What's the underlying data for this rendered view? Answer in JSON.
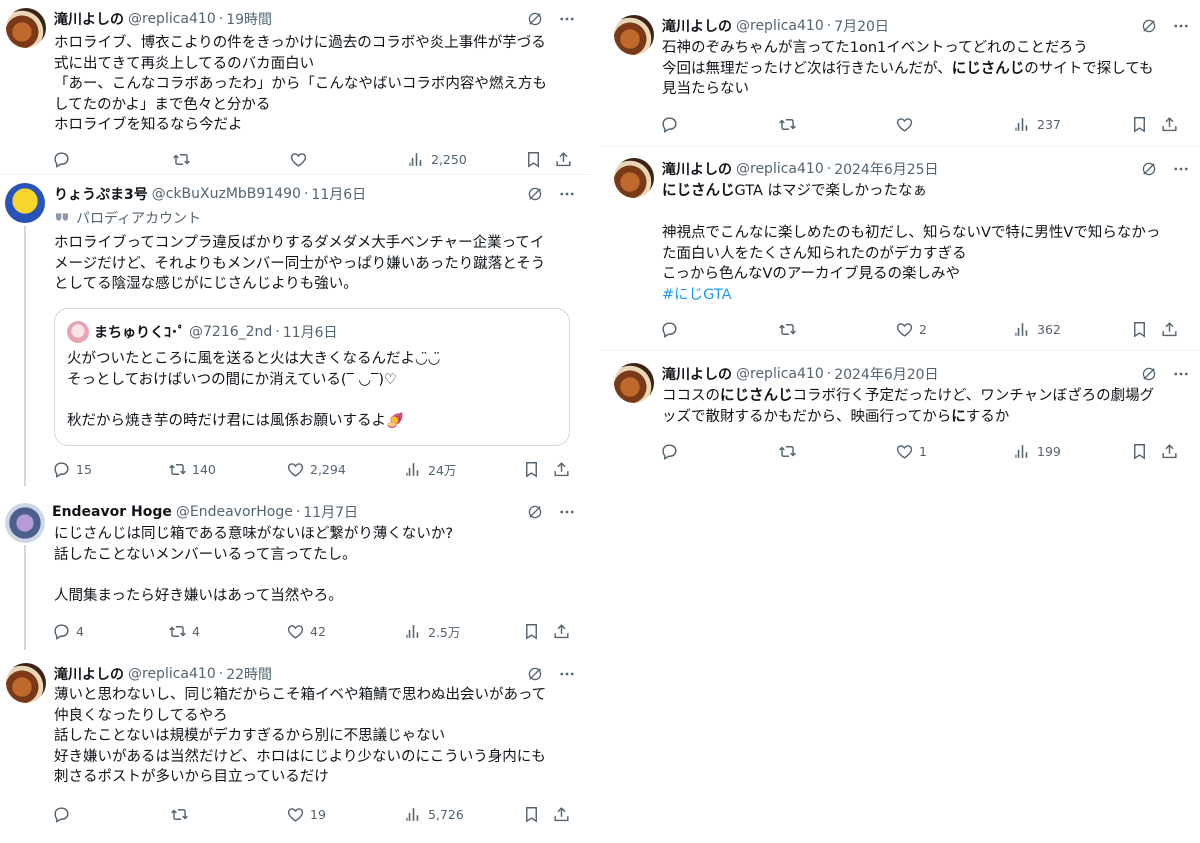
{
  "left": {
    "tweets": [
      {
        "name": "滝川よしの",
        "handle": "@replica410",
        "time": "19時間",
        "text": "ホロライブ、博衣こよりの件をきっかけに過去のコラボや炎上事件が芋づる\n式に出てきて再炎上してるのバカ面白い\n「あー、こんなコラボあったわ」から「こんなやばいコラボ内容や燃え方も\nしてたのかよ」まで色々と分かる\nホロライブを知るなら今だよ",
        "replies": "",
        "retweets": "",
        "likes": "",
        "views": "2,250"
      },
      {
        "name": "りょうぷま3号",
        "handle": "@ckBuXuzMbB91490",
        "time": "11月6日",
        "parody_label": "パロディアカウント",
        "text": "ホロライブってコンプラ違反ばかりするダメダメ大手ベンチャー企業ってイ\nメージだけど、それよりもメンバー同士がやっぱり嫌いあったり蹴落とそう\nとしてる陰湿な感じがにじさんじよりも強い。",
        "quote": {
          "name": "まちゅりくｺ･ﾟ",
          "handle": "@7216_2nd",
          "time": "11月6日",
          "text": "火がついたところに風を送ると火は大きくなるんだよ◡̈◡̈\nそっとしておけばいつの間にか消えている(‾ ◡‾)♡\n\n秋だから焼き芋の時だけ君には風係お願いするよ🍠"
        },
        "replies": "15",
        "retweets": "140",
        "likes": "2,294",
        "views": "24万"
      },
      {
        "name": "Endeavor Hoge",
        "handle": "@EndeavorHoge",
        "time": "11月7日",
        "text": "にじさんじは同じ箱である意味がないほど繋がり薄くないか?\n話したことないメンバーいるって言ってたし。\n\n人間集まったら好き嫌いはあって当然やろ。",
        "replies": "4",
        "retweets": "4",
        "likes": "42",
        "views": "2.5万"
      },
      {
        "name": "滝川よしの",
        "handle": "@replica410",
        "time": "22時間",
        "text": "薄いと思わないし、同じ箱だからこそ箱イベや箱鯖で思わぬ出会いがあって\n仲良くなったりしてるやろ\n話したことないは規模がデカすぎるから別に不思議じゃない\n好き嫌いがあるは当然だけど、ホロはにじより少ないのにこういう身内にも\n刺さるポストが多いから目立っているだけ",
        "replies": "",
        "retweets": "",
        "likes": "19",
        "views": "5,726"
      }
    ]
  },
  "right": {
    "tweets": [
      {
        "name": "滝川よしの",
        "handle": "@replica410",
        "time": "7月20日",
        "line1": "石神のぞみちゃんが言ってた1on1イベントってどれのことだろう",
        "line2_pre": "今回は無理だったけど次は行きたいんだが、",
        "line2_bold": "にじさんじ",
        "line2_post": "のサイトで探しても",
        "line3": "見当たらない",
        "replies": "",
        "retweets": "",
        "likes": "",
        "views": "237"
      },
      {
        "name": "滝川よしの",
        "handle": "@replica410",
        "time": "2024年6月25日",
        "line1_bold": "にじさんじ",
        "line1_post": "GTA はマジで楽しかったなぁ",
        "text": "神視点でこんなに楽しめたのも初だし、知らないVで特に男性Vで知らなかっ\nた面白い人をたくさん知られたのがデカすぎる\nこっから色んなVのアーカイブ見るの楽しみや",
        "hashtag": "#にじGTA",
        "replies": "",
        "retweets": "",
        "likes": "2",
        "views": "362"
      },
      {
        "name": "滝川よしの",
        "handle": "@replica410",
        "time": "2024年6月20日",
        "line1_pre": "ココスの",
        "line1_bold": "にじさんじ",
        "line1_post": "コラボ行く予定だったけど、ワンチャンぼざろの劇場グ",
        "line2_pre": "ッズで散財するかもだから、映画行ってから",
        "line2_bold": "に",
        "line2_post": "するか",
        "replies": "",
        "retweets": "",
        "likes": "1",
        "views": "199"
      }
    ]
  },
  "icons": {
    "reply": "reply-icon",
    "retweet": "retweet-icon",
    "like": "heart-icon",
    "views": "views-icon",
    "bookmark": "bookmark-icon",
    "share": "share-icon",
    "grok": "grok-icon",
    "more": "more-icon"
  }
}
